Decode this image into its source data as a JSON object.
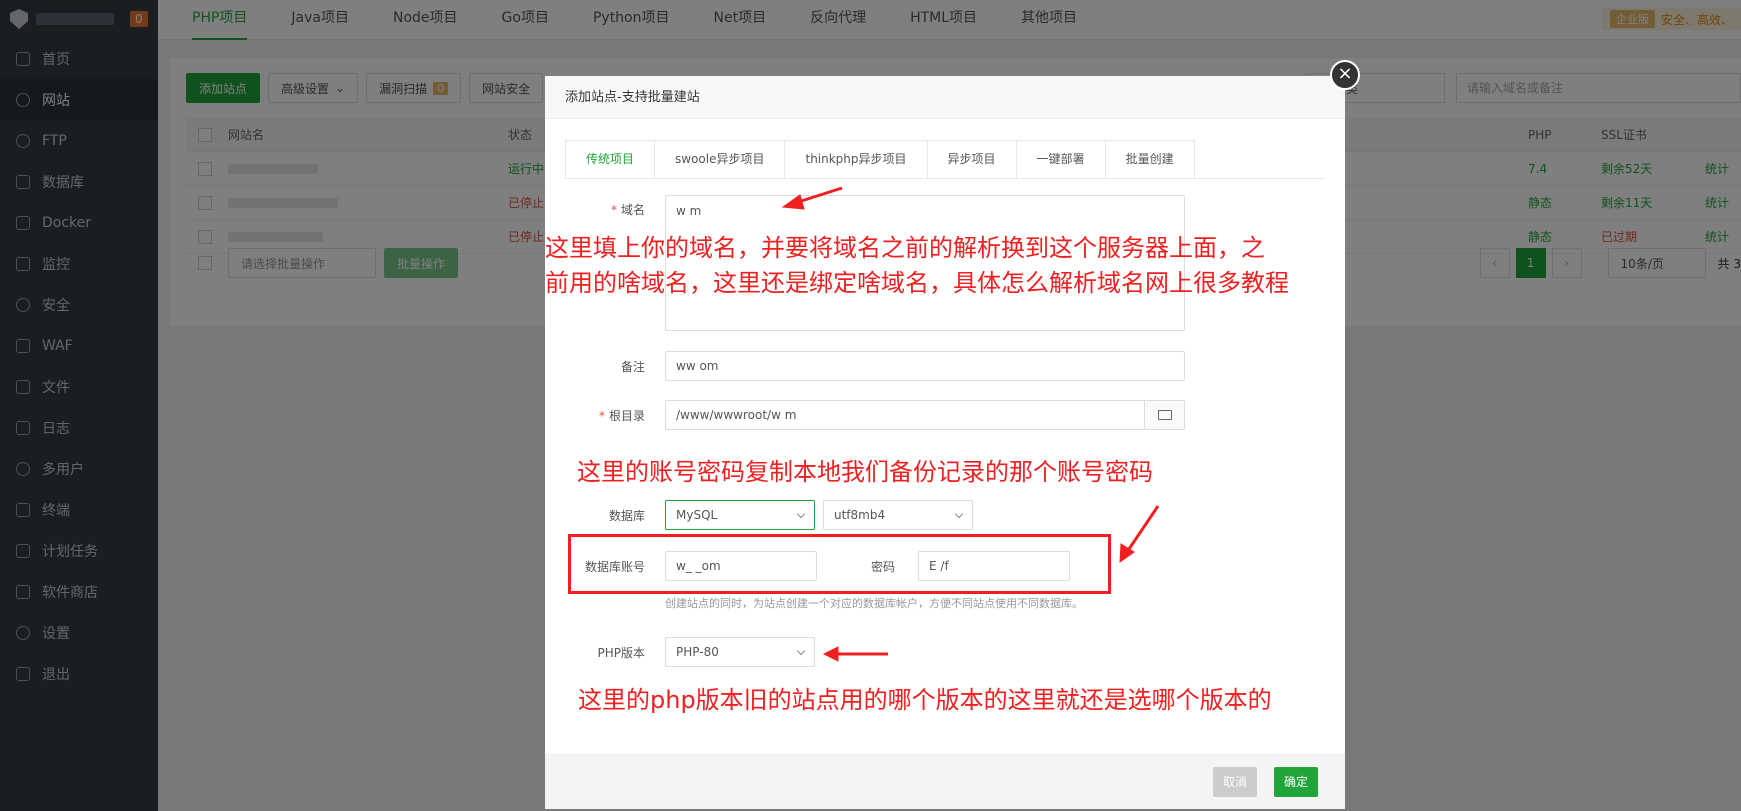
{
  "sidebar": {
    "badge": "0",
    "items": [
      {
        "label": "首页",
        "icon": "home-icon"
      },
      {
        "label": "网站",
        "icon": "globe-icon"
      },
      {
        "label": "FTP",
        "icon": "ftp-icon"
      },
      {
        "label": "数据库",
        "icon": "database-icon"
      },
      {
        "label": "Docker",
        "icon": "docker-icon"
      },
      {
        "label": "监控",
        "icon": "monitor-icon"
      },
      {
        "label": "安全",
        "icon": "shield-icon"
      },
      {
        "label": "WAF",
        "icon": "waf-icon"
      },
      {
        "label": "文件",
        "icon": "folder-icon"
      },
      {
        "label": "日志",
        "icon": "log-icon"
      },
      {
        "label": "多用户",
        "icon": "users-icon"
      },
      {
        "label": "终端",
        "icon": "terminal-icon"
      },
      {
        "label": "计划任务",
        "icon": "calendar-icon"
      },
      {
        "label": "软件商店",
        "icon": "store-icon"
      },
      {
        "label": "设置",
        "icon": "gear-icon"
      },
      {
        "label": "退出",
        "icon": "logout-icon"
      }
    ]
  },
  "topbar": {
    "tabs": [
      "PHP项目",
      "Java项目",
      "Node项目",
      "Go项目",
      "Python项目",
      "Net项目",
      "反向代理",
      "HTML项目",
      "其他项目"
    ],
    "enterprise_badge": "企业版",
    "enterprise_text": "安全、高效、"
  },
  "toolbar": {
    "add_site": "添加站点",
    "advanced": "高级设置",
    "vuln_scan": "漏洞扫描",
    "vuln_count": "0",
    "site_security": "网站安全",
    "search_placeholder": "请输入域名或备注",
    "category": "类"
  },
  "table": {
    "headers": {
      "name": "网站名",
      "status": "状态",
      "php": "PHP",
      "ssl": "SSL证书"
    },
    "rows": [
      {
        "status": "运行中",
        "php": "7.4",
        "ssl": "剩余52天",
        "stat": "统计"
      },
      {
        "status": "已停止",
        "php": "静态",
        "ssl": "剩余11天",
        "stat": "统计"
      },
      {
        "status": "已停止",
        "php": "静态",
        "ssl": "已过期",
        "stat": "统计"
      }
    ],
    "batch_placeholder": "请选择批量操作",
    "batch_button": "批量操作",
    "page": "1",
    "page_size": "10条/页",
    "total": "共 3"
  },
  "dialog": {
    "title": "添加站点-支持批量建站",
    "tabs": [
      "传统项目",
      "swoole异步项目",
      "thinkphp异步项目",
      "异步项目",
      "一键部署",
      "批量创建"
    ],
    "domain_label": "域名",
    "domain_value": "w          m",
    "remark_label": "备注",
    "remark_value": "ww          om",
    "root_label": "根目录",
    "root_value": "/www/wwwroot/w            m",
    "db_label": "数据库",
    "db_type": "MySQL",
    "db_charset": "utf8mb4",
    "db_user_label": "数据库账号",
    "db_user_value": "w_          _om",
    "db_pass_label": "密码",
    "db_pass_value": "E             /f",
    "db_hint": "创建站点的同时，为站点创建一个对应的数据库帐户，方便不同站点使用不同数据库。",
    "php_label": "PHP版本",
    "php_value": "PHP-80",
    "cancel": "取消",
    "ok": "确定"
  },
  "annotations": {
    "domain_note_1": "这里填上你的域名，并要将域名之前的解析换到这个服务器上面，之",
    "domain_note_2": "前用的啥域名，这里还是绑定啥域名，具体怎么解析域名网上很多教程",
    "db_note": "这里的账号密码复制本地我们备份记录的那个账号密码",
    "php_note": "这里的php版本旧的站点用的哪个版本的这里就还是选哪个版本的"
  }
}
